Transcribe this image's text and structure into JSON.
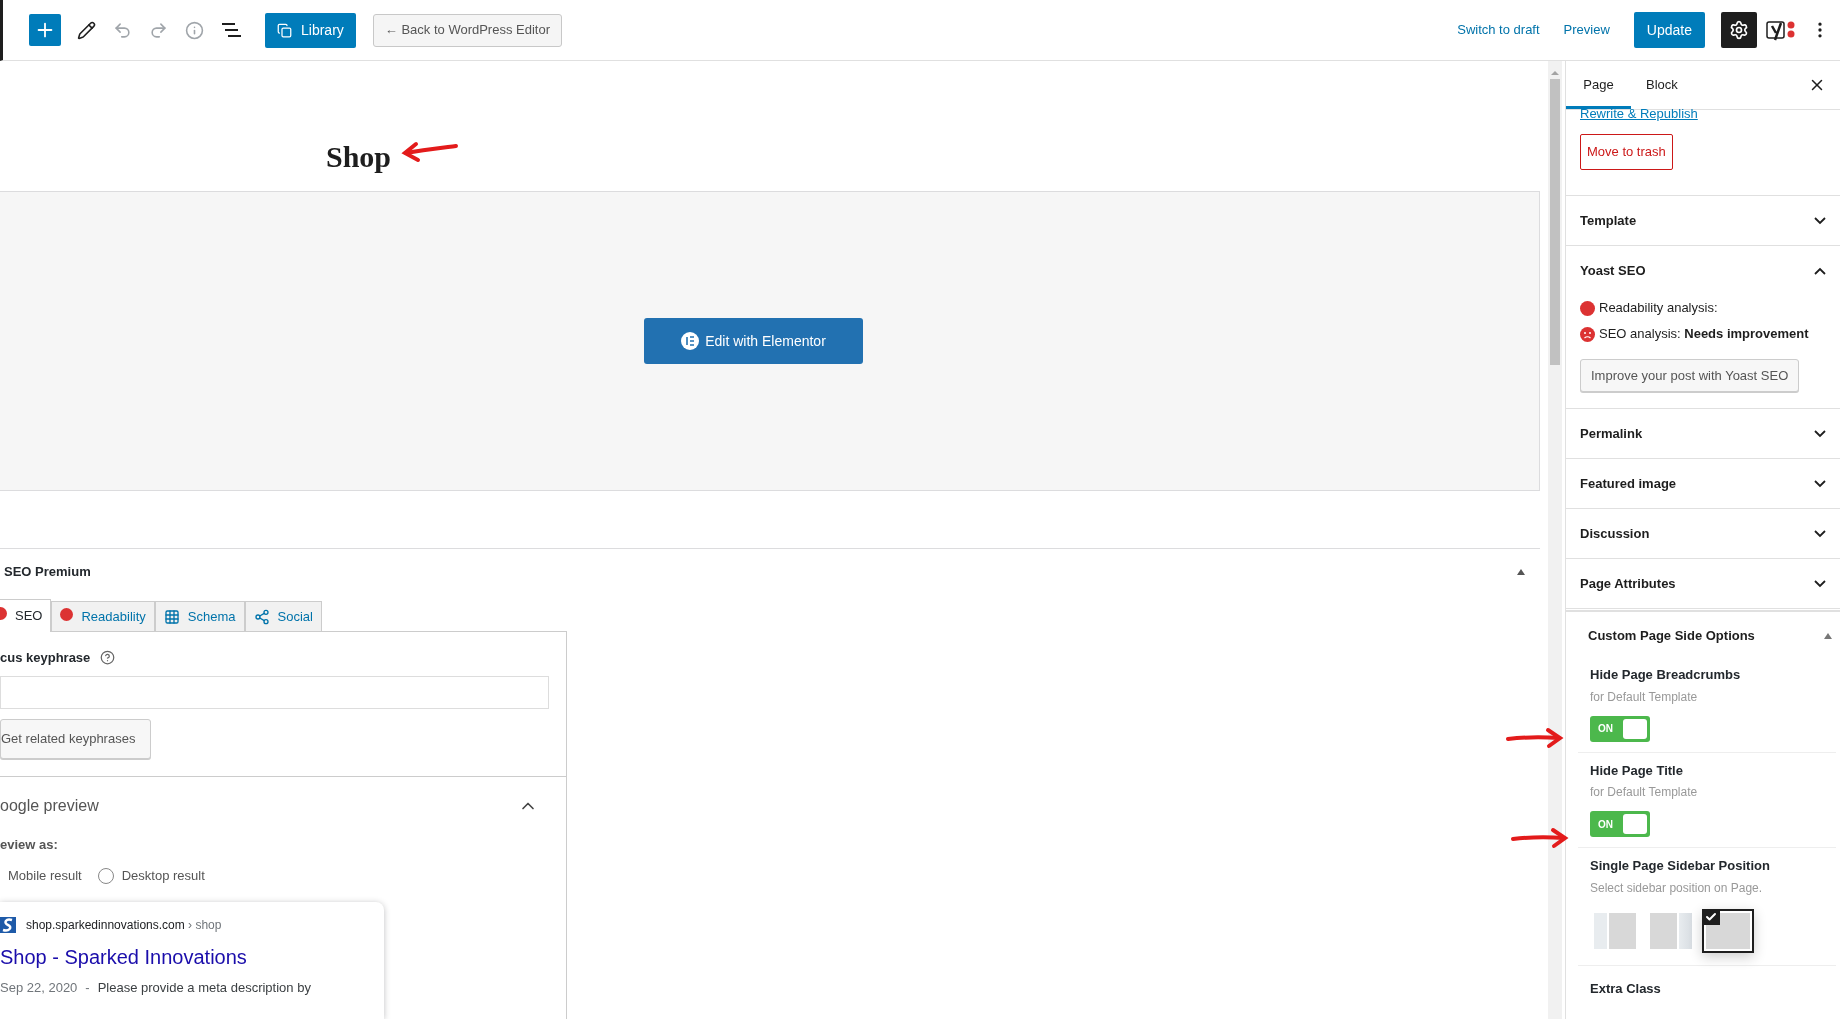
{
  "toolbar": {
    "library": "Library",
    "back": "← Back to WordPress Editor",
    "switch_draft": "Switch to draft",
    "preview": "Preview",
    "update": "Update"
  },
  "editor": {
    "title": "Shop",
    "elementor_button": "Edit with Elementor"
  },
  "yoast_box": {
    "title": "SEO Premium",
    "tabs": [
      {
        "label": "SEO",
        "kind": "dot",
        "color": "#dc3232",
        "selected": true
      },
      {
        "label": "Readability",
        "kind": "dot",
        "color": "#dc3232",
        "selected": false
      },
      {
        "label": "Schema",
        "kind": "grid",
        "selected": false
      },
      {
        "label": "Social",
        "kind": "share",
        "selected": false
      }
    ],
    "focus_label": "cus keyphrase",
    "related_button": "Get related keyphrases",
    "google_preview": {
      "title": "oogle preview",
      "expanded": true
    },
    "preview_as": "eview as:",
    "mobile_label": "Mobile result",
    "radios": [
      {
        "label": "Desktop result",
        "selected": false
      }
    ],
    "card": {
      "url": "shop.sparkedinnovations.com",
      "crumb": "› shop",
      "title": "Shop - Sparked Innovations",
      "date": "Sep 22, 2020",
      "separator": "-",
      "description": "Please provide a meta description by"
    }
  },
  "sidebar": {
    "tabs": [
      {
        "label": "Page",
        "selected": true
      },
      {
        "label": "Block",
        "selected": false
      }
    ],
    "rewrite_link": "Rewrite & Republish",
    "trash_button": "Move to trash",
    "sections": [
      {
        "title": "Template",
        "expanded": false
      },
      {
        "title": "Yoast SEO",
        "expanded": true
      },
      {
        "title": "Permalink",
        "expanded": false
      },
      {
        "title": "Featured image",
        "expanded": false
      },
      {
        "title": "Discussion",
        "expanded": false
      },
      {
        "title": "Page Attributes",
        "expanded": false
      }
    ],
    "yoast": {
      "analyses": [
        {
          "text": "Readability analysis:",
          "kind": "dot",
          "color": "#dc3232"
        },
        {
          "text": "SEO analysis: **Needs improvement**",
          "kind": "face",
          "color": "#dc3232"
        }
      ],
      "button": "Improve your post with Yoast SEO"
    },
    "custom": {
      "title": "Custom Page Side Options",
      "expanded": true,
      "toggles": [
        {
          "label": "Hide Page Breadcrumbs",
          "hint": "for Default Template",
          "on": true,
          "text": "ON"
        },
        {
          "label": "Hide Page Title",
          "hint": "for Default Template",
          "on": true,
          "text": "ON"
        }
      ],
      "position": {
        "label": "Single Page Sidebar Position",
        "hint": "Select sidebar position on Page.",
        "options": [
          {
            "kind": "left",
            "selected": false
          },
          {
            "kind": "right",
            "selected": false
          },
          {
            "kind": "none",
            "selected": true
          }
        ]
      },
      "extra_class": "Extra Class"
    }
  }
}
